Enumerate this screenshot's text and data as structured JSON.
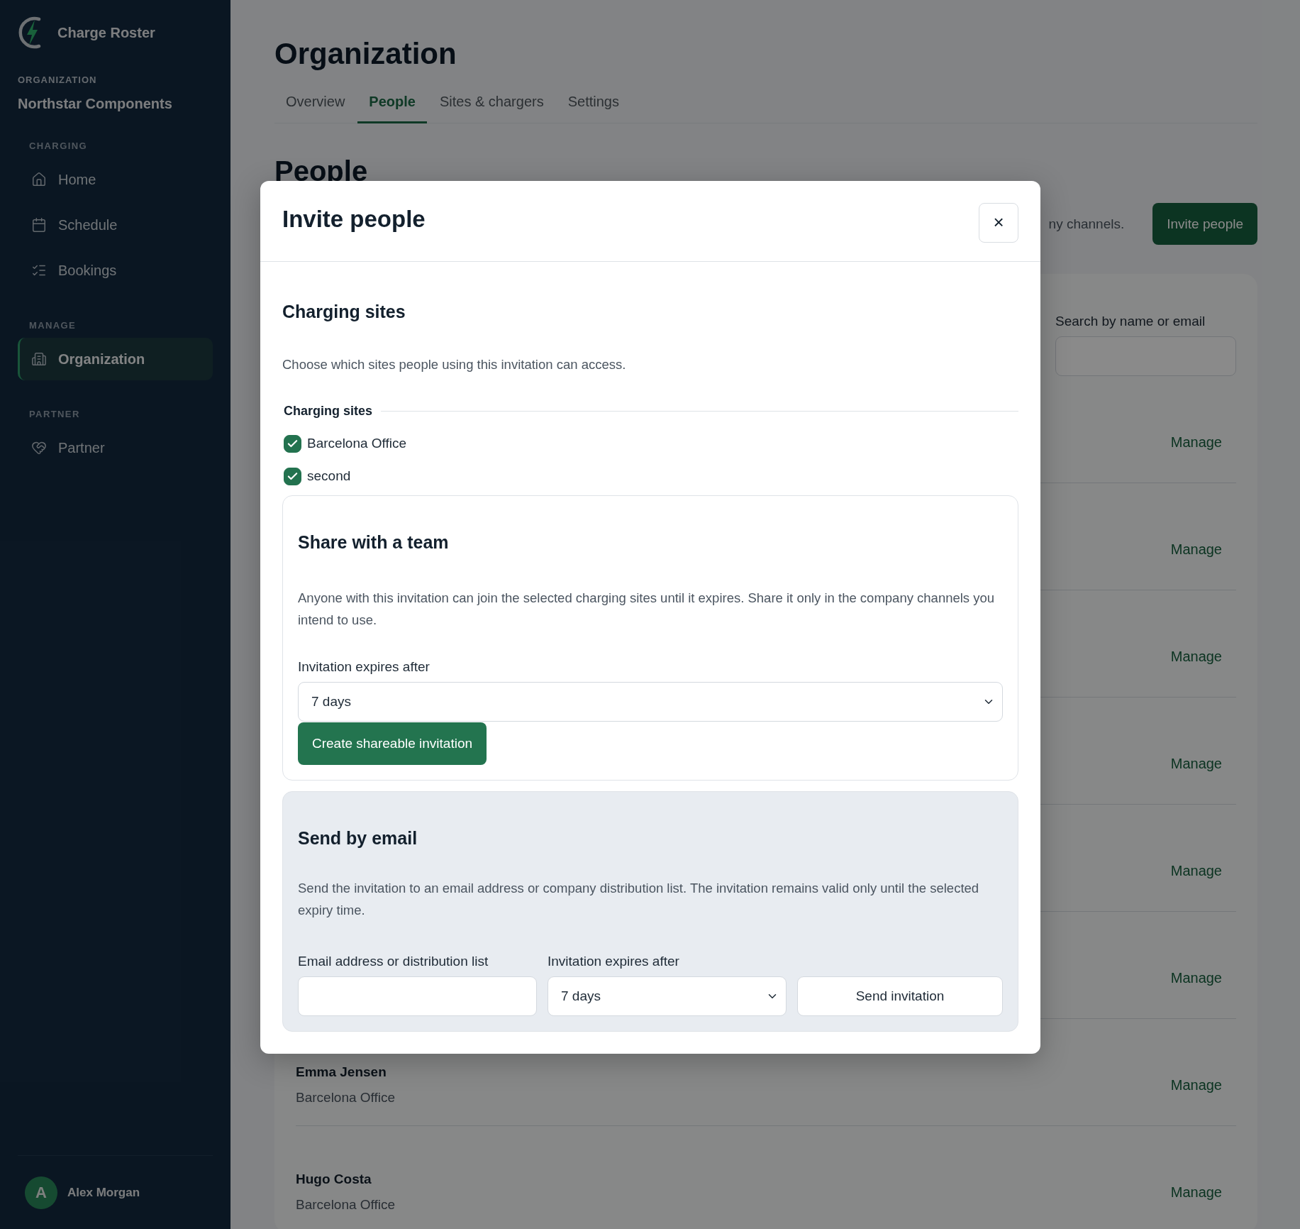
{
  "sidebar": {
    "brand": "Charge Roster",
    "org_label": "ORGANIZATION",
    "org_name": "Northstar Components",
    "sections": [
      {
        "heading": "CHARGING",
        "items": [
          {
            "label": "Home",
            "selected": false
          },
          {
            "label": "Schedule",
            "selected": false
          },
          {
            "label": "Bookings",
            "selected": false
          }
        ]
      },
      {
        "heading": "MANAGE",
        "items": [
          {
            "label": "Organization",
            "selected": true
          }
        ]
      },
      {
        "heading": "PARTNER",
        "items": [
          {
            "label": "Partner",
            "selected": false
          }
        ]
      }
    ],
    "user": {
      "initial": "A",
      "name": "Alex Morgan"
    }
  },
  "page": {
    "title": "Organization",
    "tabs": [
      {
        "label": "Overview",
        "selected": false
      },
      {
        "label": "People",
        "selected": true
      },
      {
        "label": "Sites & chargers",
        "selected": false
      },
      {
        "label": "Settings",
        "selected": false
      }
    ],
    "section_title": "People",
    "description": "ny channels.",
    "invite_button": "Invite people",
    "search": {
      "label": "Search by name or email"
    },
    "rows": [
      {
        "action": "Manage"
      },
      {
        "action": "Manage"
      },
      {
        "action": "Manage"
      },
      {
        "action": "Manage"
      },
      {
        "action": "Manage"
      },
      {
        "action": "Manage"
      },
      {
        "name": "Emma Jensen",
        "site": "Barcelona Office",
        "action": "Manage"
      },
      {
        "name": "Hugo Costa",
        "site": "Barcelona Office",
        "action": "Manage"
      }
    ]
  },
  "modal": {
    "title": "Invite people",
    "close": "×",
    "sites": {
      "title": "Charging sites",
      "description": "Choose which sites people using this invitation can access.",
      "legend": "Charging sites",
      "items": [
        {
          "label": "Barcelona Office",
          "checked": true
        },
        {
          "label": "second",
          "checked": true
        }
      ]
    },
    "team": {
      "title": "Share with a team",
      "description": "Anyone with this invitation can join the selected charging sites until it expires. Share it only in the company channels you intend to use.",
      "expiry_label": "Invitation expires after",
      "expiry_value": "7 days",
      "button": "Create shareable invitation"
    },
    "email": {
      "title": "Send by email",
      "description": "Send the invitation to an email address or company distribution list. The invitation remains valid only until the selected expiry time.",
      "email_label": "Email address or distribution list",
      "expiry_label": "Invitation expires after",
      "expiry_value": "7 days",
      "button": "Send invitation"
    }
  }
}
